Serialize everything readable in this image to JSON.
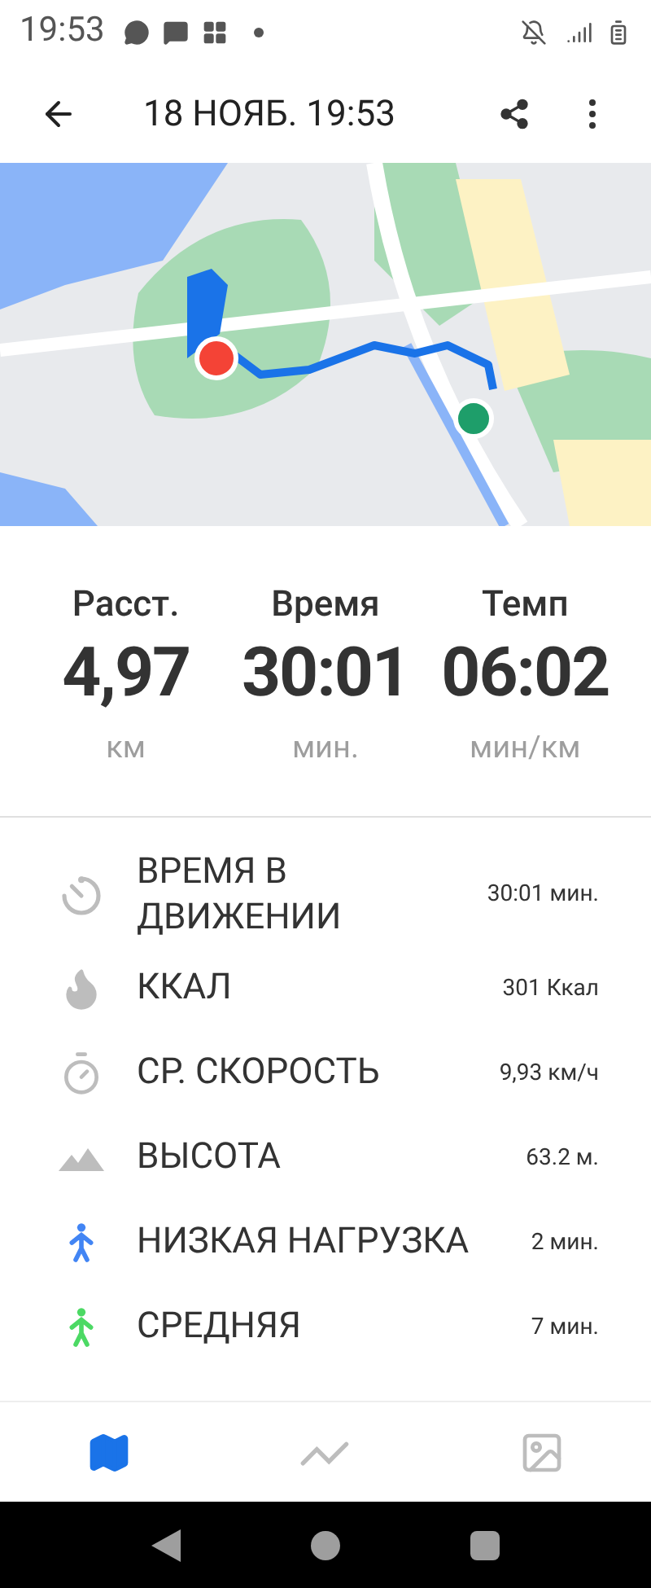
{
  "status_bar": {
    "time": "19:53"
  },
  "toolbar": {
    "title": "18 НОЯБ. 19:53"
  },
  "summary": [
    {
      "label": "Расст.",
      "value": "4,97",
      "unit": "км"
    },
    {
      "label": "Время",
      "value": "30:01",
      "unit": "мин."
    },
    {
      "label": "Темп",
      "value": "06:02",
      "unit": "мин/км"
    }
  ],
  "metrics": [
    {
      "kind": "moving",
      "label": "ВРЕМЯ В ДВИЖЕНИИ",
      "value": "30:01 мин."
    },
    {
      "kind": "calories",
      "label": "ККАЛ",
      "value": "301 Ккал"
    },
    {
      "kind": "speed",
      "label": "СР. СКОРОСТЬ",
      "value": "9,93 км/ч"
    },
    {
      "kind": "altitude",
      "label": "ВЫСОТА",
      "value": "63.2 м."
    },
    {
      "kind": "walker",
      "label": "НИЗКАЯ НАГРУЗКА",
      "value": "2 мин.",
      "color": "#4285f4"
    },
    {
      "kind": "walker",
      "label": "СРЕДНЯЯ",
      "value": "7 мин.",
      "color": "#4cd964"
    }
  ],
  "bottom_tabs": [
    {
      "kind": "map",
      "selected": true
    },
    {
      "kind": "chart",
      "selected": false
    },
    {
      "kind": "photos",
      "selected": false
    }
  ]
}
